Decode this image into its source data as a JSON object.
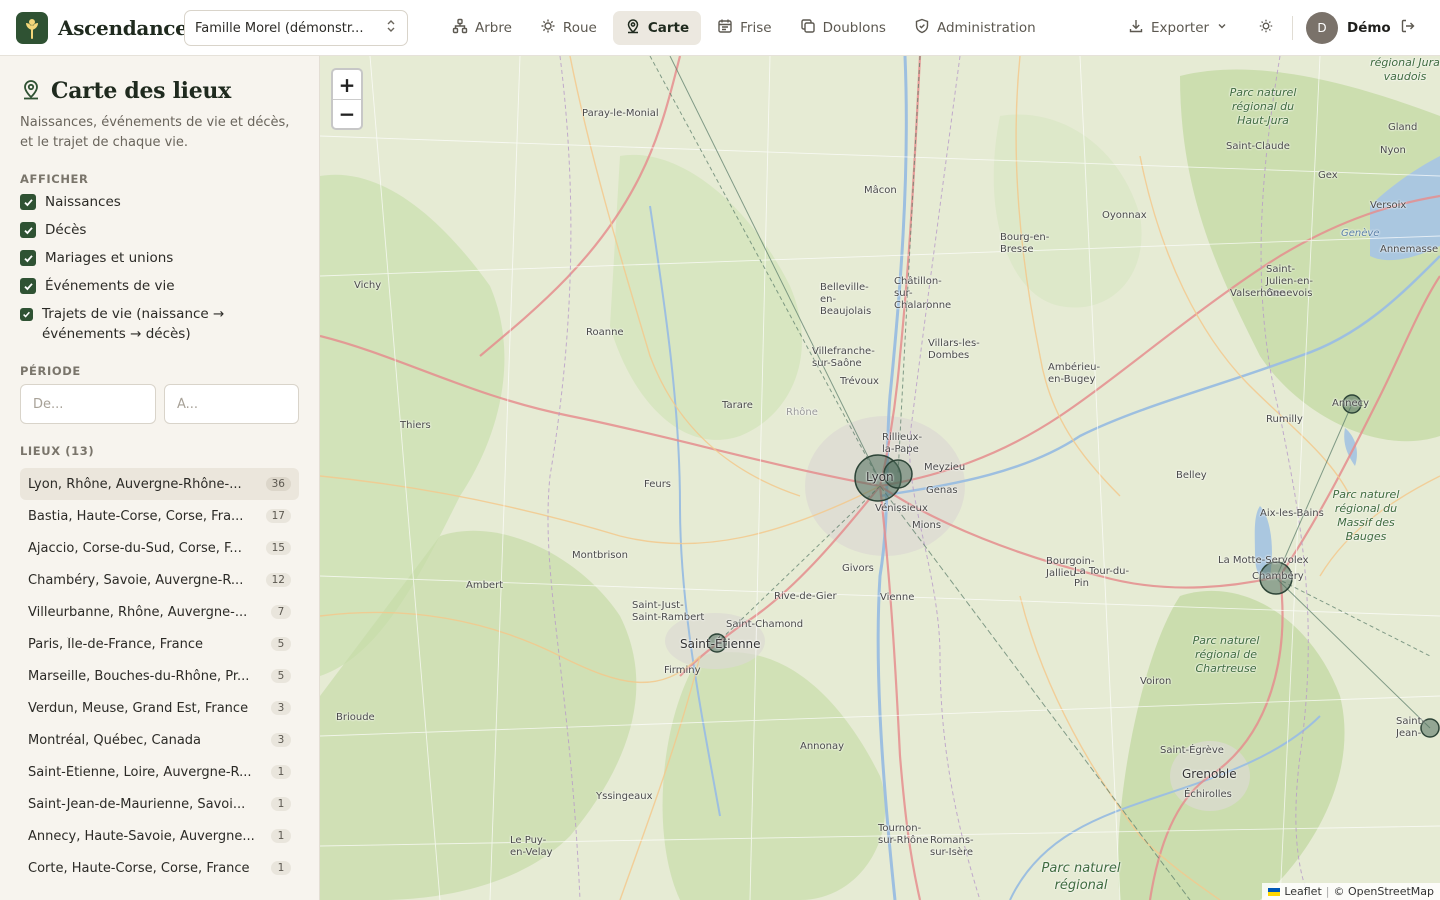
{
  "app": {
    "name": "Ascendance",
    "tree_select": "Famille Morel (démonstr..."
  },
  "nav": [
    {
      "label": "Arbre",
      "icon": "tree-icon"
    },
    {
      "label": "Roue",
      "icon": "sun-icon"
    },
    {
      "label": "Carte",
      "icon": "map-pin-icon",
      "active": true
    },
    {
      "label": "Frise",
      "icon": "calendar-icon"
    },
    {
      "label": "Doublons",
      "icon": "copy-icon"
    },
    {
      "label": "Administration",
      "icon": "shield-icon"
    }
  ],
  "header": {
    "export_label": "Exporter",
    "user_initial": "D",
    "user_name": "Démo"
  },
  "sidebar": {
    "title": "Carte des lieux",
    "description": "Naissances, événements de vie et décès, et le trajet de chaque vie.",
    "show_label": "AFFICHER",
    "filters": [
      {
        "label": "Naissances",
        "checked": true
      },
      {
        "label": "Décès",
        "checked": true
      },
      {
        "label": "Mariages et unions",
        "checked": true
      },
      {
        "label": "Événements de vie",
        "checked": true
      },
      {
        "label": "Trajets de vie (naissance → événements → décès)",
        "checked": true
      }
    ],
    "period_label": "PÉRIODE",
    "period_from_placeholder": "De...",
    "period_to_placeholder": "À...",
    "places_label": "LIEUX (13)",
    "places": [
      {
        "name": "Lyon, Rhône, Auvergne-Rhône-...",
        "count": "36",
        "active": true
      },
      {
        "name": "Bastia, Haute-Corse, Corse, Fra...",
        "count": "17"
      },
      {
        "name": "Ajaccio, Corse-du-Sud, Corse, F...",
        "count": "15"
      },
      {
        "name": "Chambéry, Savoie, Auvergne-R...",
        "count": "12"
      },
      {
        "name": "Villeurbanne, Rhône, Auvergne-...",
        "count": "7"
      },
      {
        "name": "Paris, Île-de-France, France",
        "count": "5"
      },
      {
        "name": "Marseille, Bouches-du-Rhône, Pr...",
        "count": "5"
      },
      {
        "name": "Verdun, Meuse, Grand Est, France",
        "count": "3"
      },
      {
        "name": "Montréal, Québec, Canada",
        "count": "3"
      },
      {
        "name": "Saint-Étienne, Loire, Auvergne-R...",
        "count": "1"
      },
      {
        "name": "Saint-Jean-de-Maurienne, Savoi...",
        "count": "1"
      },
      {
        "name": "Annecy, Haute-Savoie, Auvergne...",
        "count": "1"
      },
      {
        "name": "Corte, Haute-Corse, Corse, France",
        "count": "1"
      }
    ]
  },
  "map": {
    "zoom_in": "+",
    "zoom_out": "−",
    "attribution_leaflet": "Leaflet",
    "attribution_sep": "|",
    "attribution_osm": "© OpenStreetMap",
    "labels": {
      "paray": "Paray-le-Monial",
      "macon": "Mâcon",
      "bourg": "Bourg-en-Bresse",
      "oyonnax": "Oyonnax",
      "vichy": "Vichy",
      "roanne": "Roanne",
      "belleville": "Belleville-en-Beaujolais",
      "chatillon": "Châtillon-sur-Chalaronne",
      "villars": "Villars-les-Dombes",
      "villefranche": "Villefranche-sur-Saône",
      "trevoux": "Trévoux",
      "amberieu": "Ambérieu-en-Bugey",
      "tarare": "Tarare",
      "rhone": "Rhône",
      "thiers": "Thiers",
      "rillieux": "Rillieux-la-Pape",
      "meyzieu": "Meyzieu",
      "lyon": "Lyon",
      "genas": "Genas",
      "venissieux": "Vénissieux",
      "mions": "Mions",
      "feurs": "Feurs",
      "montbrison": "Montbrison",
      "ambert": "Ambert",
      "givors": "Givors",
      "bourgoin": "Bourgoin-Jallieu",
      "latour": "La Tour-du-Pin",
      "rive": "Rive-de-Gier",
      "vienne": "Vienne",
      "saintjust": "Saint-Just-Saint-Rambert",
      "saintchamond": "Saint-Chamond",
      "saintetienne": "Saint-Étienne",
      "firminy": "Firminy",
      "brioude": "Brioude",
      "annonay": "Annonay",
      "yssingeaux": "Yssingeaux",
      "lepuy": "Le Puy-en-Velay",
      "tournon": "Tournon-sur-Rhône",
      "romans": "Romans-sur-Isère",
      "voiron": "Voiron",
      "grenoble": "Grenoble",
      "echirolles": "Échirolles",
      "saintegreve": "Saint-Égrève",
      "belley": "Belley",
      "rumilly": "Rumilly",
      "annecy": "Annecy",
      "aixlesbains": "Aix-les-Bains",
      "lamotte": "La Motte-Servolex",
      "chambery": "Chambéry",
      "saintjulien": "Saint-Julien-en-Genevois",
      "valserhone": "Valserhône",
      "geneve": "Genève",
      "annemasse": "Annemasse",
      "versoix": "Versoix",
      "gex": "Gex",
      "nyon": "Nyon",
      "gland": "Gland",
      "saintclaude": "Saint-Claude",
      "saintjean": "Saint-Jean-de-Maurienne",
      "park_hautjura": "Parc naturel régional du Haut-Jura",
      "park_juravaudois": "régional Jura vaudois",
      "park_bauges": "Parc naturel régional du Massif des Bauges",
      "park_chartreuse": "Parc naturel régional de Chartreuse",
      "park_bottom": "Parc naturel régional"
    }
  }
}
